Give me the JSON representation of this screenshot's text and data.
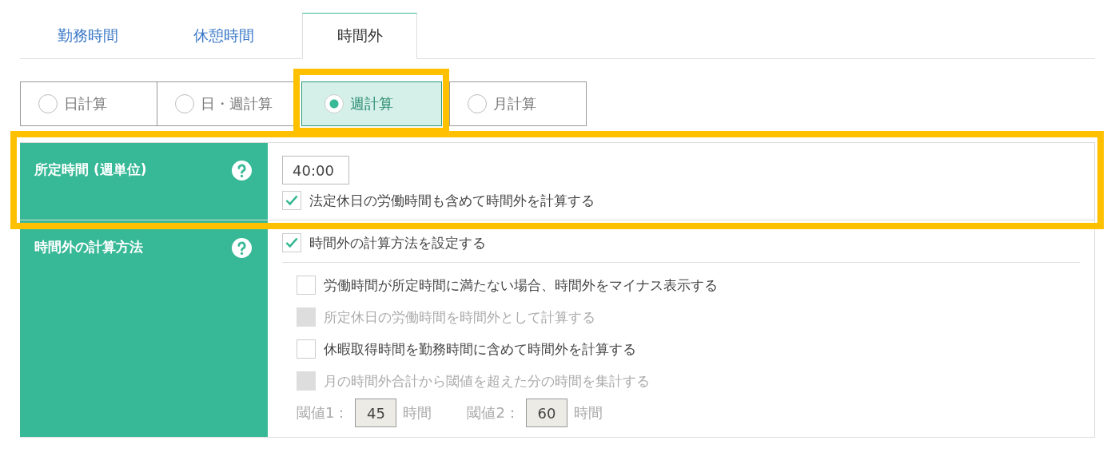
{
  "tabs": [
    {
      "label": "勤務時間",
      "selected": false
    },
    {
      "label": "休憩時間",
      "selected": false
    },
    {
      "label": "時間外",
      "selected": true
    }
  ],
  "calc_modes": [
    {
      "label": "日計算",
      "selected": false,
      "highlighted": false
    },
    {
      "label": "日・週計算",
      "selected": false,
      "highlighted": false
    },
    {
      "label": "週計算",
      "selected": true,
      "highlighted": true
    },
    {
      "label": "月計算",
      "selected": false,
      "highlighted": false
    }
  ],
  "sections": [
    {
      "kind": "prescribed",
      "label": "所定時間 (週単位)",
      "highlighted": true,
      "time_value": "40:00",
      "option": {
        "label": "法定休日の労働時間も含めて時間外を計算する",
        "checked": true,
        "disabled": false
      }
    },
    {
      "kind": "method",
      "label": "時間外の計算方法",
      "highlighted": false,
      "option": {
        "label": "時間外の計算方法を設定する",
        "checked": true,
        "disabled": false
      },
      "sub_options": [
        {
          "label": "労働時間が所定時間に満たない場合、時間外をマイナス表示する",
          "checked": false,
          "disabled": false
        },
        {
          "label": "所定休日の労働時間を時間外として計算する",
          "checked": false,
          "disabled": true
        },
        {
          "label": "休暇取得時間を勤務時間に含めて時間外を計算する",
          "checked": false,
          "disabled": false
        },
        {
          "label": "月の時間外合計から閾値を超えた分の時間を集計する",
          "checked": false,
          "disabled": true
        }
      ],
      "thresholds": [
        {
          "label": "閾値1：",
          "value": "45",
          "unit": "時間",
          "disabled": true
        },
        {
          "label": "閾値2：",
          "value": "60",
          "unit": "時間",
          "disabled": true
        }
      ]
    }
  ]
}
